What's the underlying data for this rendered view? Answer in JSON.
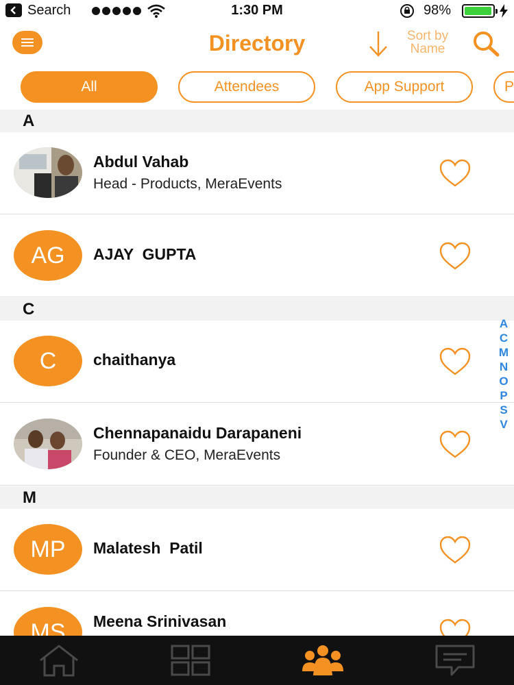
{
  "status_bar": {
    "back_app": "Search",
    "time": "1:30 PM",
    "battery_percent": "98%",
    "battery_level": 0.98,
    "signal_dots": 5
  },
  "header": {
    "menu_icon": "hamburger-menu-icon",
    "title": "Directory",
    "sort_line1": "Sort by",
    "sort_line2": "Name",
    "search_icon": "search-icon"
  },
  "filters": {
    "items": [
      {
        "label": "All",
        "active": true
      },
      {
        "label": "Attendees",
        "active": false
      },
      {
        "label": "App Support",
        "active": false
      },
      {
        "label": "P",
        "active": false
      }
    ]
  },
  "sections": {
    "a": "A",
    "c": "C",
    "m": "M"
  },
  "people": [
    {
      "name": "Abdul Vahab",
      "subtitle": "Head - Products, MeraEvents",
      "initials": "",
      "avatar": "photo",
      "favorite": false
    },
    {
      "name": "AJAY  GUPTA",
      "subtitle": "",
      "initials": "AG",
      "avatar": "initials",
      "favorite": false
    },
    {
      "name": "chaithanya",
      "subtitle": "",
      "initials": "C",
      "avatar": "initials",
      "favorite": false
    },
    {
      "name": "Chennapanaidu Darapaneni",
      "subtitle": "Founder & CEO, MeraEvents",
      "initials": "",
      "avatar": "photo",
      "favorite": false
    },
    {
      "name": "Malatesh  Patil",
      "subtitle": "",
      "initials": "MP",
      "avatar": "initials",
      "favorite": false
    },
    {
      "name": "Meena Srinivasan",
      "subtitle": "",
      "initials": "MS",
      "avatar": "initials",
      "favorite": false
    }
  ],
  "alphabet_index": [
    "A",
    "C",
    "M",
    "N",
    "O",
    "P",
    "S",
    "V"
  ],
  "tab_bar": {
    "items": [
      {
        "icon": "home-icon",
        "active": false
      },
      {
        "icon": "grid-icon",
        "active": false
      },
      {
        "icon": "people-icon",
        "active": true
      },
      {
        "icon": "chat-icon",
        "active": false
      }
    ]
  },
  "colors": {
    "accent": "#f39223",
    "index_blue": "#2e86de",
    "section_bg": "#f2f2f2",
    "tab_bar_bg": "#111111"
  }
}
